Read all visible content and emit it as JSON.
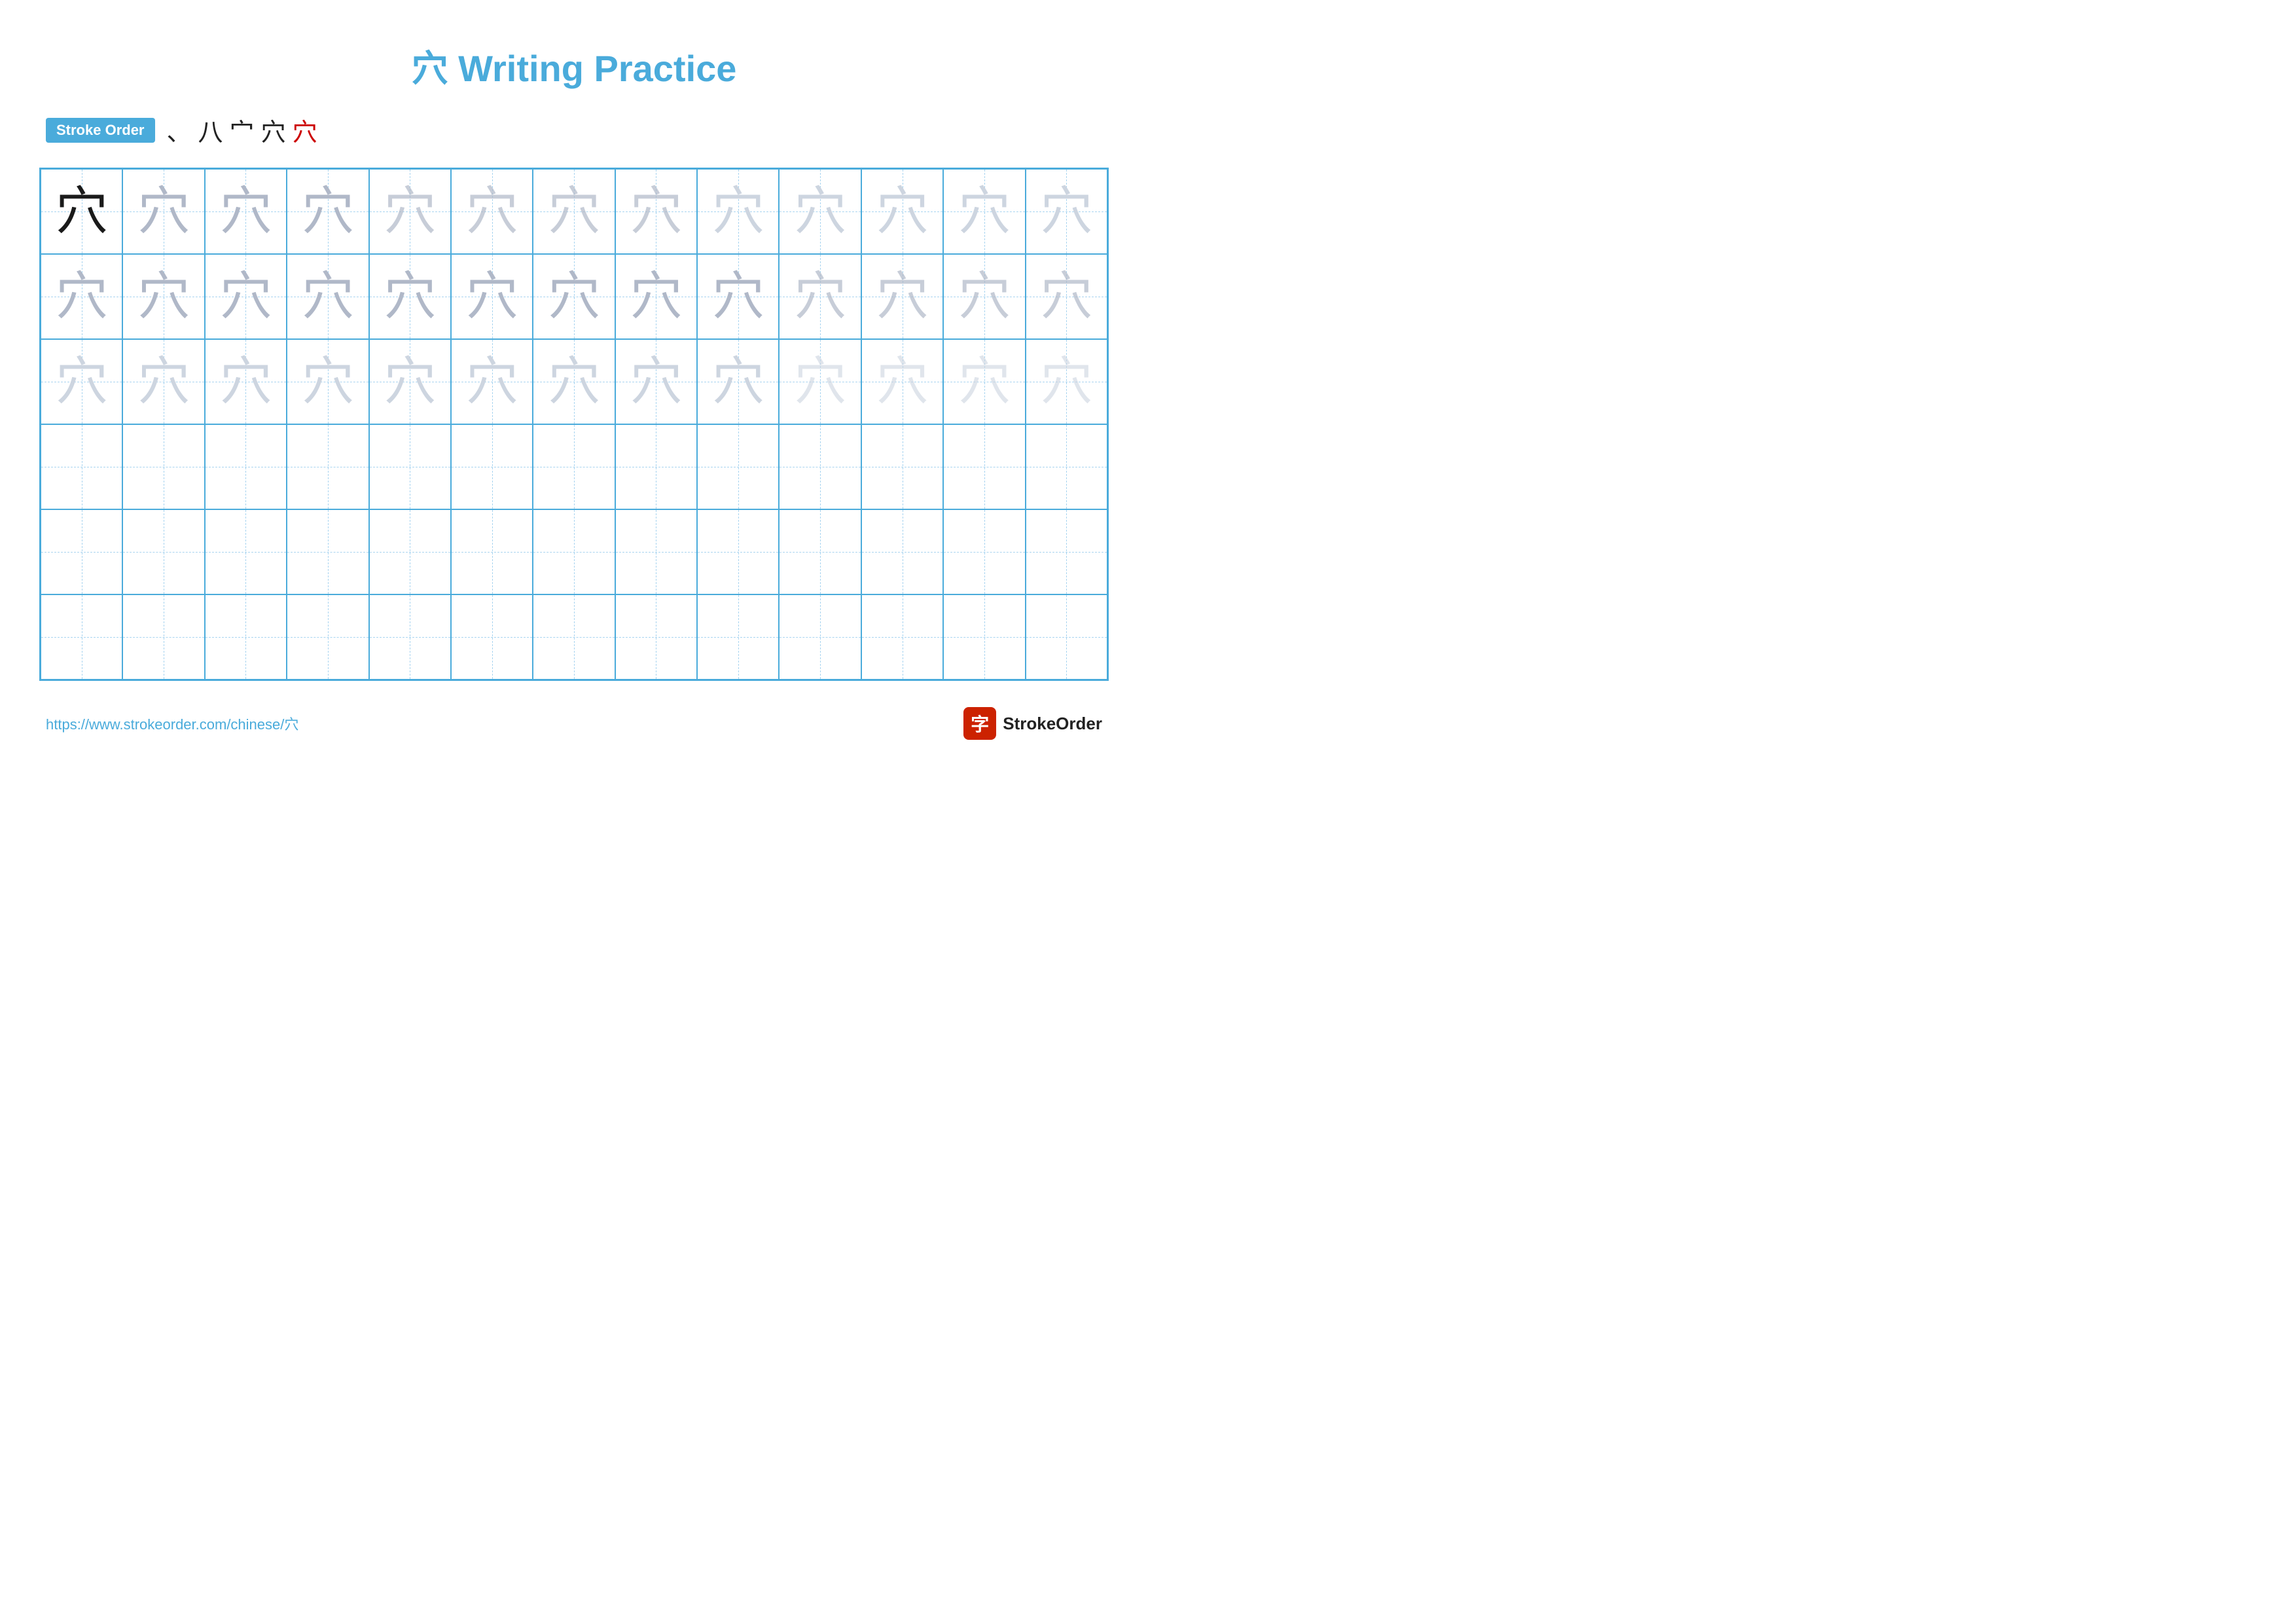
{
  "page": {
    "title": "穴 Writing Practice",
    "stroke_order_label": "Stroke Order",
    "stroke_chars": [
      "、",
      "八",
      "宀",
      "穴",
      "穴"
    ],
    "stroke_chars_last_red": true,
    "url": "https://www.strokeorder.com/chinese/穴",
    "logo_text": "StrokeOrder",
    "logo_icon": "字",
    "character": "穴",
    "rows": 6,
    "cols": 13,
    "row_configs": [
      {
        "type": "dark-then-graded"
      },
      {
        "type": "gray-medium"
      },
      {
        "type": "gray-light"
      },
      {
        "type": "empty"
      },
      {
        "type": "empty"
      },
      {
        "type": "empty"
      }
    ]
  }
}
